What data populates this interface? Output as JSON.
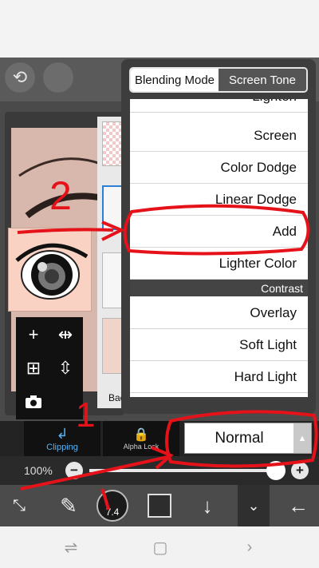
{
  "popup": {
    "tabs": [
      "Blending Mode",
      "Screen Tone"
    ],
    "modes_top": [
      "Lighten",
      "Screen",
      "Color Dodge",
      "Linear Dodge",
      "Add",
      "Lighter Color"
    ],
    "group_header": "Contrast",
    "modes_bottom": [
      "Overlay",
      "Soft Light",
      "Hard Light"
    ],
    "selected_mode": "Add"
  },
  "controls": {
    "clipping_label": "Clipping",
    "alpha_lock_label": "Alpha Lock",
    "blend_value": "Normal",
    "opacity_text": "100%",
    "opacity_value": 1.0,
    "brush_size": "7.4",
    "layer_caption": "Bac"
  },
  "annotations": {
    "step1": "1",
    "step2": "2"
  },
  "colors": {
    "accent": "#5ab2f0",
    "annotation": "#e5121a"
  },
  "icons": [
    "undo-icon",
    "plus-icon",
    "flip-horizontal-icon",
    "add-layer-icon",
    "flip-vertical-icon",
    "camera-icon",
    "clipping-icon",
    "alpha-lock-icon",
    "brush-icon",
    "arrow-down-icon",
    "arrow-left-icon"
  ]
}
